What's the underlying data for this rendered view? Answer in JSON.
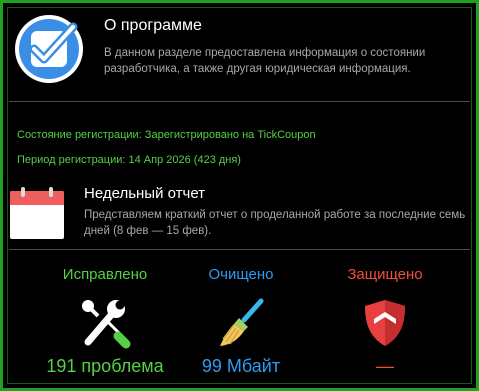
{
  "header": {
    "icon": "checkmark-badge-icon",
    "title": "О программе",
    "description": "В данном разделе предоставлена информация о состоянии разработчика, а также другая юридическая информация."
  },
  "registration": {
    "status": "Состояние регистрации: Зарегистрировано на TickCoupon",
    "period": "Период регистрации: 14 Апр 2026 (423 дня)"
  },
  "weekly_report": {
    "icon": "calendar-icon",
    "title": "Недельный отчет",
    "description": "Представляем краткий отчет о проделанной работе за последние семь дней (8 фев — 15 фев)."
  },
  "stats": [
    {
      "label": "Исправлено",
      "value": "191 проблема",
      "icon": "tools-icon",
      "color": "#55d045"
    },
    {
      "label": "Очищено",
      "value": "99 Мбайт",
      "icon": "broom-icon",
      "color": "#2f9bf0"
    },
    {
      "label": "Защищено",
      "value": "—",
      "icon": "shield-icon",
      "color": "#f0503a"
    }
  ],
  "colors": {
    "frame": "#1fa21f",
    "accent_green": "#55d045",
    "accent_blue": "#2f9bf0",
    "accent_red": "#f0503a"
  }
}
